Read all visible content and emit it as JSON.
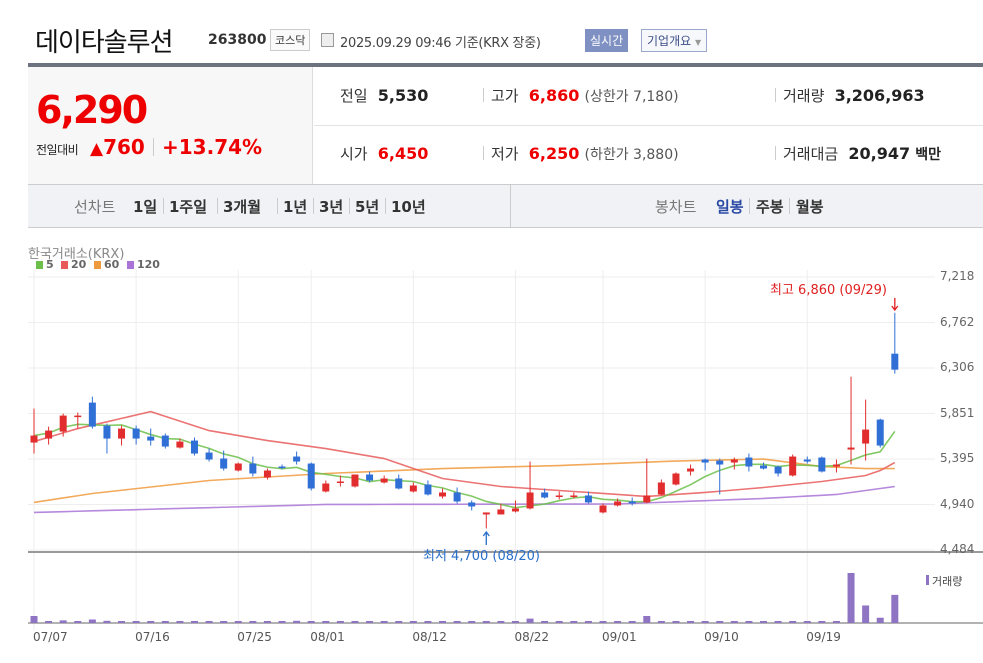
{
  "header": {
    "name": "데이타솔루션",
    "code": "263800",
    "market": "코스닥",
    "asof": "2025.09.29 09:46 기준(KRX 장중)",
    "realtime_button": "실시간",
    "company_button": "기업개요"
  },
  "quote": {
    "price": "6,290",
    "change_label": "전일대비",
    "change_arrow": "▲",
    "change": "760",
    "change_pct": "+13.74%",
    "prev_label": "전일",
    "prev": "5,530",
    "open_label": "시가",
    "open": "6,450",
    "high_label": "고가",
    "high": "6,860",
    "upper_limit": "(상한가 7,180)",
    "low_label": "저가",
    "low": "6,250",
    "lower_limit": "(하한가 3,880)",
    "volume_label": "거래량",
    "volume": "3,206,963",
    "amount_label": "거래대금",
    "amount": "20,947",
    "amount_unit": "백만"
  },
  "tabs": {
    "line_label": "선차트",
    "line": [
      "1일",
      "1주일",
      "3개월",
      "1년",
      "3년",
      "5년",
      "10년"
    ],
    "candle_label": "봉차트",
    "candle": [
      "일봉",
      "주봉",
      "월봉"
    ],
    "candle_active": 0
  },
  "colors": {
    "up": "#e12d2d",
    "down": "#2f6fd6",
    "ma5": "#6cbf4a",
    "ma20": "#e85a5a",
    "ma60": "#f09a3e",
    "ma120": "#a974d6",
    "volume": "#8f74c4"
  },
  "chart_data": {
    "type": "candlestick",
    "source": "한국거래소(KRX)",
    "legend": [
      "5",
      "20",
      "60",
      "120"
    ],
    "volume_label": "거래량",
    "yticks": [
      "7,218",
      "6,762",
      "6,306",
      "5,851",
      "5,395",
      "4,940",
      "4,484"
    ],
    "ylim": [
      4484,
      7218
    ],
    "xticks": [
      {
        "i": 0,
        "label": "07/07"
      },
      {
        "i": 7,
        "label": "07/16"
      },
      {
        "i": 14,
        "label": "07/25"
      },
      {
        "i": 19,
        "label": "08/01"
      },
      {
        "i": 26,
        "label": "08/12"
      },
      {
        "i": 33,
        "label": "08/22"
      },
      {
        "i": 39,
        "label": "09/01"
      },
      {
        "i": 46,
        "label": "09/10"
      },
      {
        "i": 53,
        "label": "09/19"
      }
    ],
    "high_note": "최고 6,860 (09/29)",
    "low_note": "최저 4,700 (08/20)",
    "high_index": 59,
    "low_index": 31,
    "ohlc": [
      [
        5560,
        5900,
        5450,
        5630
      ],
      [
        5600,
        5720,
        5540,
        5680
      ],
      [
        5670,
        5850,
        5620,
        5830
      ],
      [
        5820,
        5860,
        5700,
        5830
      ],
      [
        5960,
        6020,
        5700,
        5720
      ],
      [
        5730,
        5750,
        5450,
        5600
      ],
      [
        5600,
        5730,
        5530,
        5700
      ],
      [
        5700,
        5730,
        5540,
        5600
      ],
      [
        5620,
        5700,
        5530,
        5580
      ],
      [
        5630,
        5650,
        5500,
        5520
      ],
      [
        5510,
        5600,
        5500,
        5570
      ],
      [
        5580,
        5610,
        5430,
        5450
      ],
      [
        5460,
        5500,
        5370,
        5390
      ],
      [
        5400,
        5480,
        5280,
        5300
      ],
      [
        5280,
        5360,
        5270,
        5350
      ],
      [
        5350,
        5420,
        5220,
        5250
      ],
      [
        5210,
        5300,
        5190,
        5280
      ],
      [
        5320,
        5340,
        5290,
        5310
      ],
      [
        5420,
        5470,
        5340,
        5370
      ],
      [
        5350,
        5360,
        5080,
        5100
      ],
      [
        5070,
        5180,
        5060,
        5150
      ],
      [
        5160,
        5230,
        5120,
        5170
      ],
      [
        5120,
        5240,
        5110,
        5240
      ],
      [
        5240,
        5270,
        5160,
        5180
      ],
      [
        5160,
        5230,
        5150,
        5200
      ],
      [
        5200,
        5240,
        5090,
        5100
      ],
      [
        5070,
        5160,
        5060,
        5130
      ],
      [
        5140,
        5180,
        5030,
        5040
      ],
      [
        5020,
        5100,
        5000,
        5060
      ],
      [
        5060,
        5110,
        4950,
        4970
      ],
      [
        4960,
        4980,
        4880,
        4920
      ],
      [
        4840,
        4860,
        4700,
        4860
      ],
      [
        4840,
        4950,
        4840,
        4890
      ],
      [
        4870,
        4980,
        4860,
        4900
      ],
      [
        4900,
        5370,
        4890,
        5060
      ],
      [
        5060,
        5100,
        5000,
        5010
      ],
      [
        5020,
        5070,
        4990,
        5030
      ],
      [
        5020,
        5060,
        5000,
        5030
      ],
      [
        5030,
        5070,
        4950,
        4960
      ],
      [
        4860,
        4950,
        4850,
        4930
      ],
      [
        4930,
        5000,
        4920,
        4970
      ],
      [
        4970,
        5010,
        4930,
        4950
      ],
      [
        4960,
        5400,
        4950,
        5030
      ],
      [
        5040,
        5190,
        5030,
        5160
      ],
      [
        5140,
        5260,
        5130,
        5250
      ],
      [
        5270,
        5340,
        5230,
        5300
      ],
      [
        5390,
        5400,
        5280,
        5360
      ],
      [
        5380,
        5400,
        5040,
        5340
      ],
      [
        5360,
        5410,
        5290,
        5390
      ],
      [
        5410,
        5450,
        5270,
        5320
      ],
      [
        5330,
        5360,
        5290,
        5300
      ],
      [
        5320,
        5330,
        5220,
        5250
      ],
      [
        5230,
        5440,
        5220,
        5420
      ],
      [
        5390,
        5420,
        5350,
        5370
      ],
      [
        5410,
        5420,
        5260,
        5270
      ],
      [
        5320,
        5390,
        5260,
        5340
      ],
      [
        5490,
        6220,
        5340,
        5510
      ],
      [
        5550,
        5990,
        5380,
        5690
      ],
      [
        5790,
        5800,
        5510,
        5530
      ],
      [
        6450,
        6860,
        6250,
        6290
      ]
    ],
    "volume_k": [
      800,
      200,
      300,
      200,
      400,
      250,
      200,
      200,
      200,
      200,
      150,
      200,
      200,
      200,
      150,
      200,
      150,
      200,
      250,
      200,
      150,
      150,
      150,
      150,
      150,
      150,
      200,
      150,
      150,
      200,
      200,
      150,
      200,
      150,
      500,
      200,
      150,
      150,
      150,
      150,
      150,
      150,
      800,
      200,
      200,
      200,
      200,
      200,
      150,
      150,
      150,
      150,
      200,
      150,
      200,
      200,
      5700,
      2000,
      600,
      3207
    ],
    "ma20_pts": [
      [
        0,
        5570
      ],
      [
        3,
        5700
      ],
      [
        8,
        5870
      ],
      [
        12,
        5680
      ],
      [
        16,
        5580
      ],
      [
        20,
        5500
      ],
      [
        24,
        5400
      ],
      [
        28,
        5200
      ],
      [
        32,
        5120
      ],
      [
        36,
        5080
      ],
      [
        40,
        5040
      ],
      [
        42,
        5020
      ],
      [
        46,
        5060
      ],
      [
        50,
        5110
      ],
      [
        54,
        5170
      ],
      [
        57,
        5230
      ],
      [
        58,
        5280
      ],
      [
        59,
        5360
      ]
    ],
    "ma60_pts": [
      [
        0,
        4960
      ],
      [
        4,
        5050
      ],
      [
        12,
        5180
      ],
      [
        20,
        5250
      ],
      [
        28,
        5300
      ],
      [
        36,
        5330
      ],
      [
        44,
        5375
      ],
      [
        50,
        5395
      ],
      [
        54,
        5320
      ],
      [
        57,
        5300
      ],
      [
        59,
        5300
      ]
    ],
    "ma120_pts": [
      [
        0,
        4860
      ],
      [
        20,
        4940
      ],
      [
        40,
        4945
      ],
      [
        50,
        5000
      ],
      [
        55,
        5040
      ],
      [
        59,
        5120
      ]
    ]
  }
}
